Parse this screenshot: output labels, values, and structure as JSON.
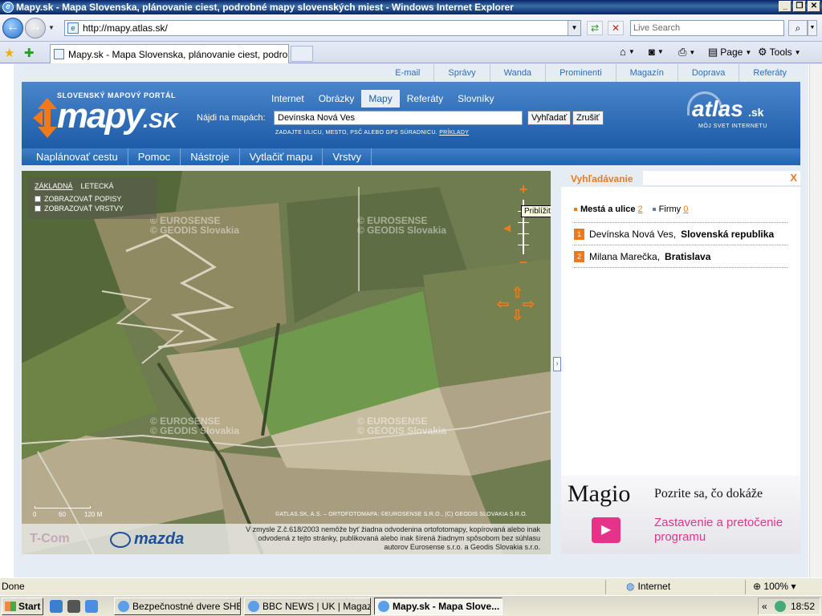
{
  "window": {
    "title": "Mapy.sk - Mapa Slovenska, plánovanie ciest, podrobné mapy slovenských miest - Windows Internet Explorer"
  },
  "browser": {
    "url": "http://mapy.atlas.sk/",
    "search_placeholder": "Live Search",
    "tab_title": "Mapy.sk - Mapa Slovenska, plánovanie ciest, podrobn...",
    "cmd_page": "Page",
    "cmd_tools": "Tools"
  },
  "site": {
    "toplinks": [
      "E-mail",
      "Správy",
      "Wanda",
      "Prominenti",
      "Magazín",
      "Doprava",
      "Referáty"
    ],
    "logo_tagline": "SLOVENSKÝ MAPOVÝ PORTÁL",
    "logo_name": "mapy",
    "logo_tld": ".SK",
    "search_tabs": [
      {
        "label": "Internet",
        "active": false
      },
      {
        "label": "Obrázky",
        "active": false
      },
      {
        "label": "Mapy",
        "active": true
      },
      {
        "label": "Referáty",
        "active": false
      },
      {
        "label": "Slovníky",
        "active": false
      }
    ],
    "search_label": "Nájdi na mapách:",
    "search_value": "Devínska Nová Ves",
    "search_button": "Vyhľadať",
    "cancel_button": "Zrušiť",
    "search_hint": "ZADAJTE ULICU, MESTO, PSČ ALEBO GPS SÚRADNICU.",
    "search_hint_link": "PRÍKLADY",
    "atlas_name": "atlas",
    "atlas_tld": ".sk",
    "atlas_slogan": "MÔJ SVET INTERNETU",
    "menu": [
      "Naplánovať cestu",
      "Pomoc",
      "Nástroje",
      "Vytlačiť mapu",
      "Vrstvy"
    ]
  },
  "map": {
    "type_basic": "ZÁKLADNÁ",
    "type_aerial": "LETECKÁ",
    "show_labels": "ZOBRAZOVAŤ POPISY",
    "show_layers": "ZOBRAZOVAŤ VRSTVY",
    "zoom_in": "+",
    "zoom_out": "–",
    "tooltip": "Priblížiť mapu",
    "watermark_1": "© EUROSENSE",
    "watermark_2": "© GEODIS Slovakia",
    "scale_0": "0",
    "scale_1": "60",
    "scale_2": "120 M",
    "copyright": "©ATLAS.SK, A.S. – ORTOFOTOMAPA: ©EUROSENSE S.R.O., (C) GEODIS SLOVAKIA S.R.O.",
    "footer_tcom": "T-Com",
    "footer_mazda": "mazda",
    "legal_text": "V zmysle Z.č.618/2003 nemôže byť žiadna odvodenina ortofotomapy, kopírovaná alebo inak odvodená z tejto stránky, publikovaná alebo inak šírená žiadnym spôsobom bez súhlasu autorov Eurosense s.r.o. a Geodis Slovakia s.r.o."
  },
  "panel": {
    "tab_label": "Vyhľadávanie",
    "close": "X",
    "cat_cities": "Mestá a ulice",
    "cat_cities_count": "2",
    "cat_firms": "Firmy",
    "cat_firms_count": "0",
    "results": [
      {
        "num": "1",
        "name": "Devínska Nová Ves,",
        "region": "Slovenská republika"
      },
      {
        "num": "2",
        "name": "Milana Marečka,",
        "region": "Bratislava"
      }
    ]
  },
  "ad": {
    "brand": "Magio",
    "headline": "Pozrite sa, čo dokáže",
    "line1": "Zastavenie a pretočenie",
    "line2": "programu"
  },
  "status": {
    "done": "Done",
    "zone": "Internet",
    "zoom": "100%"
  },
  "taskbar": {
    "start": "Start",
    "tasks": [
      {
        "label": "Bezpečnostné dvere SHE...",
        "active": false
      },
      {
        "label": "BBC NEWS | UK | Magazi...",
        "active": false
      },
      {
        "label": "Mapy.sk - Mapa Slove...",
        "active": true
      }
    ],
    "clock": "18:52"
  }
}
